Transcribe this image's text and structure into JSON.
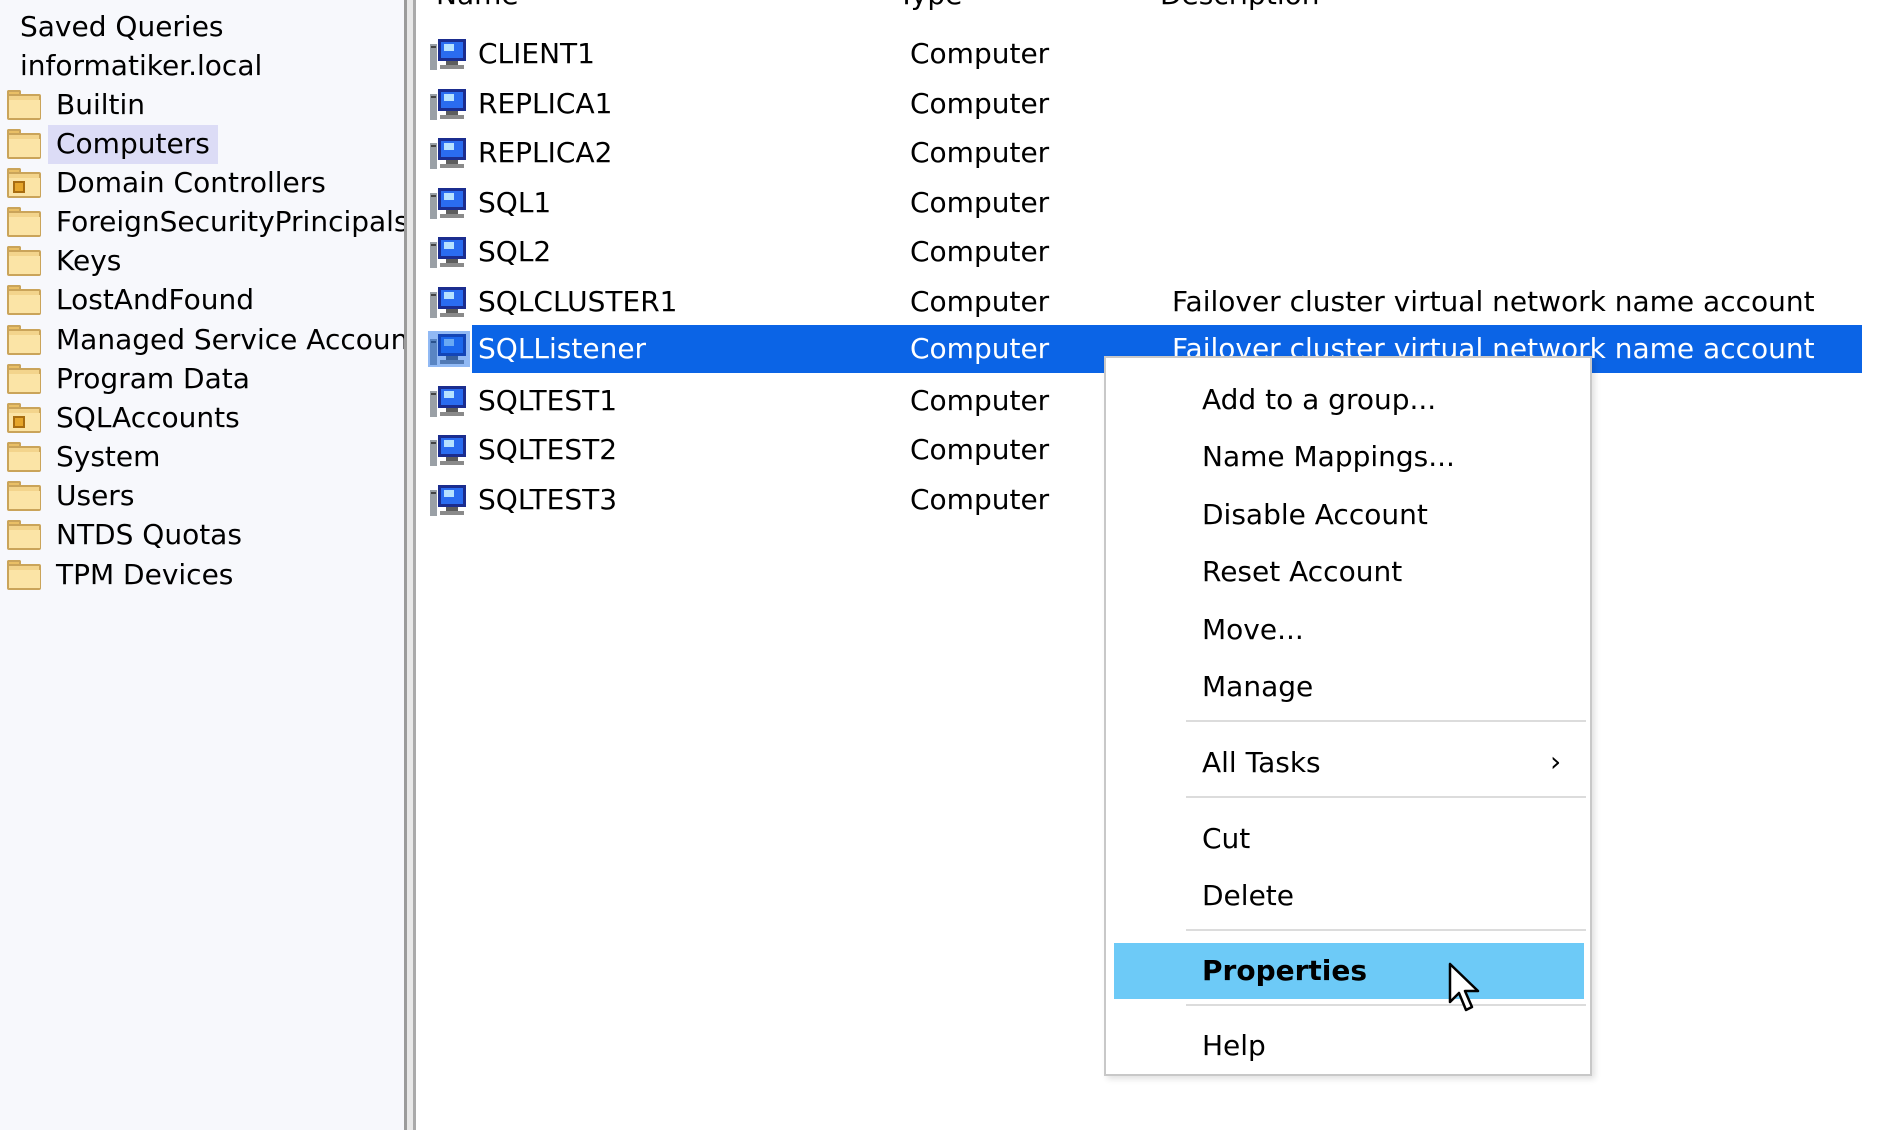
{
  "tree": {
    "items": [
      {
        "label": "Saved Queries",
        "kind": "plain"
      },
      {
        "label": "informatiker.local",
        "kind": "plain"
      },
      {
        "label": "Builtin",
        "kind": "folder"
      },
      {
        "label": "Computers",
        "kind": "folder",
        "selected": true
      },
      {
        "label": "Domain Controllers",
        "kind": "ou"
      },
      {
        "label": "ForeignSecurityPrincipals",
        "kind": "folder"
      },
      {
        "label": "Keys",
        "kind": "folder"
      },
      {
        "label": "LostAndFound",
        "kind": "folder"
      },
      {
        "label": "Managed Service Accounts",
        "kind": "folder"
      },
      {
        "label": "Program Data",
        "kind": "folder"
      },
      {
        "label": "SQLAccounts",
        "kind": "ou"
      },
      {
        "label": "System",
        "kind": "folder"
      },
      {
        "label": "Users",
        "kind": "folder"
      },
      {
        "label": "NTDS Quotas",
        "kind": "folder"
      },
      {
        "label": "TPM Devices",
        "kind": "folder"
      }
    ]
  },
  "list": {
    "columns": {
      "name": "Name",
      "type": "Type",
      "description": "Description"
    },
    "rows": [
      {
        "name": "CLIENT1",
        "type": "Computer",
        "description": ""
      },
      {
        "name": "REPLICA1",
        "type": "Computer",
        "description": ""
      },
      {
        "name": "REPLICA2",
        "type": "Computer",
        "description": ""
      },
      {
        "name": "SQL1",
        "type": "Computer",
        "description": ""
      },
      {
        "name": "SQL2",
        "type": "Computer",
        "description": ""
      },
      {
        "name": "SQLCLUSTER1",
        "type": "Computer",
        "description": "Failover cluster virtual network name account"
      },
      {
        "name": "SQLListener",
        "type": "Computer",
        "description": "Failover cluster virtual network name account",
        "selected": true
      },
      {
        "name": "SQLTEST1",
        "type": "Computer",
        "description": ""
      },
      {
        "name": "SQLTEST2",
        "type": "Computer",
        "description": ""
      },
      {
        "name": "SQLTEST3",
        "type": "Computer",
        "description": ""
      }
    ]
  },
  "context_menu": {
    "items": [
      {
        "label": "Add to a group..."
      },
      {
        "label": "Name Mappings..."
      },
      {
        "label": "Disable Account"
      },
      {
        "label": "Reset Account"
      },
      {
        "label": "Move..."
      },
      {
        "label": "Manage"
      },
      {
        "label": "All Tasks",
        "submenu": true
      },
      {
        "label": "Cut"
      },
      {
        "label": "Delete"
      },
      {
        "label": "Properties",
        "bold": true,
        "hover": true
      },
      {
        "label": "Help"
      }
    ]
  },
  "colors": {
    "selection": "#0b64e6",
    "menu_hover": "#6dcaf7",
    "tree_selection": "#dcdcf6",
    "tree_background": "#f7f8fc"
  },
  "icons": {
    "tree_item": "folder-icon",
    "list_item": "computer-icon",
    "submenu": "chevron-right-icon",
    "pointer": "mouse-pointer-icon"
  }
}
